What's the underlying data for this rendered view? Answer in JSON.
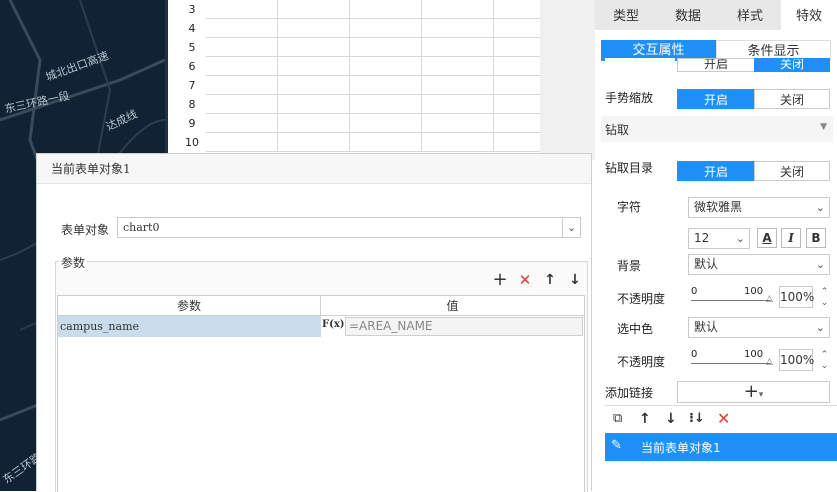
{
  "map": {
    "labels": [
      "城北出口高速",
      "东三环路一段",
      "达成线",
      "东三环路"
    ]
  },
  "sheet": {
    "row_numbers": [
      "3",
      "4",
      "5",
      "6",
      "7",
      "8",
      "9",
      "10"
    ]
  },
  "right_panel": {
    "tabs": [
      "类型",
      "数据",
      "样式",
      "特效"
    ],
    "active_tab": "特效",
    "sub_tabs": [
      "交互属性",
      "条件显示"
    ],
    "active_sub_tab": "交互属性",
    "partial_row": {
      "on": "开启",
      "off": "关闭"
    },
    "gesture_zoom": {
      "label": "手势缩放",
      "on": "开启",
      "off": "关闭"
    },
    "drill_section": "钻取",
    "drill_dir": {
      "label": "钻取目录",
      "on": "开启",
      "off": "关闭"
    },
    "font": {
      "label": "字符",
      "value": "微软雅黑",
      "size": "12",
      "bold": "B",
      "italic": "I",
      "color_btn": "A"
    },
    "background": {
      "label": "背景",
      "value": "默认"
    },
    "opacity1": {
      "label": "不透明度",
      "min": "0",
      "max": "100",
      "value": "100%"
    },
    "selected_color": {
      "label": "选中色",
      "value": "默认"
    },
    "opacity2": {
      "label": "不透明度",
      "min": "0",
      "max": "100",
      "value": "100%"
    },
    "add_link": {
      "label": "添加链接",
      "button": "+"
    },
    "link_item": "当前表单对象1"
  },
  "dialog": {
    "title": "当前表单对象1",
    "form_object_label": "表单对象",
    "form_object_value": "chart0",
    "params_label": "参数",
    "table_headers": [
      "参数",
      "值"
    ],
    "rows": [
      {
        "name": "campus_name",
        "formula_icon": "F(x)",
        "value": "=AREA_NAME"
      }
    ]
  },
  "colors": {
    "accent": "#1e90f7",
    "map_bg": "#0f2334",
    "row_selected": "#c9dceb"
  }
}
